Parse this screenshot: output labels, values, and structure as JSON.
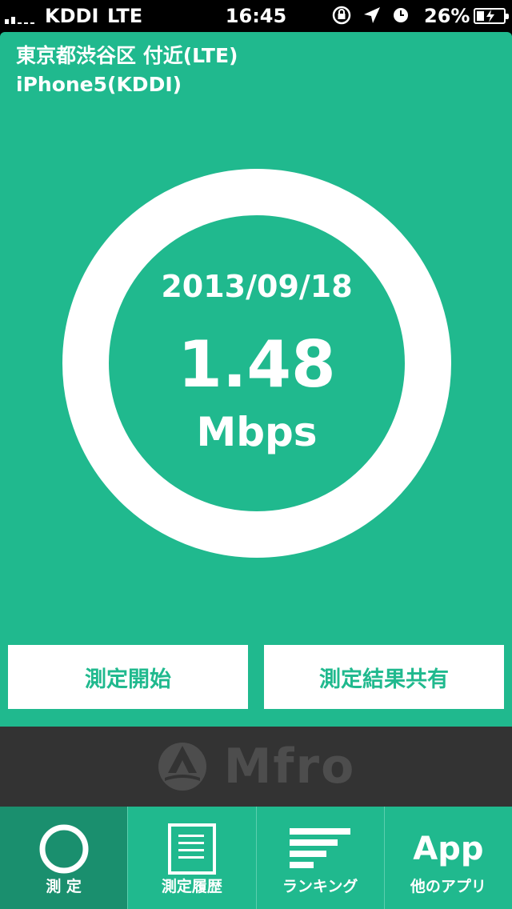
{
  "status_bar": {
    "carrier": "KDDI",
    "network": "LTE",
    "time": "16:45",
    "battery_percent": "26%"
  },
  "header": {
    "location": "東京都渋谷区 付近(LTE)",
    "device": "iPhone5(KDDI)"
  },
  "result": {
    "date": "2013/09/18",
    "speed": "1.48",
    "unit": "Mbps"
  },
  "actions": {
    "start_label": "測定開始",
    "share_label": "測定結果共有"
  },
  "brand": {
    "logo_text": "Mfro"
  },
  "tabs": [
    {
      "label": "測 定",
      "icon": "circle-icon",
      "active": true
    },
    {
      "label": "測定履歴",
      "icon": "document-icon",
      "active": false
    },
    {
      "label": "ランキング",
      "icon": "ranking-bars-icon",
      "active": false
    },
    {
      "label": "他のアプリ",
      "icon_text": "App",
      "active": false
    }
  ],
  "colors": {
    "accent": "#20b98e",
    "accent_dark": "#1a8f6e",
    "logo_band": "#333333"
  }
}
